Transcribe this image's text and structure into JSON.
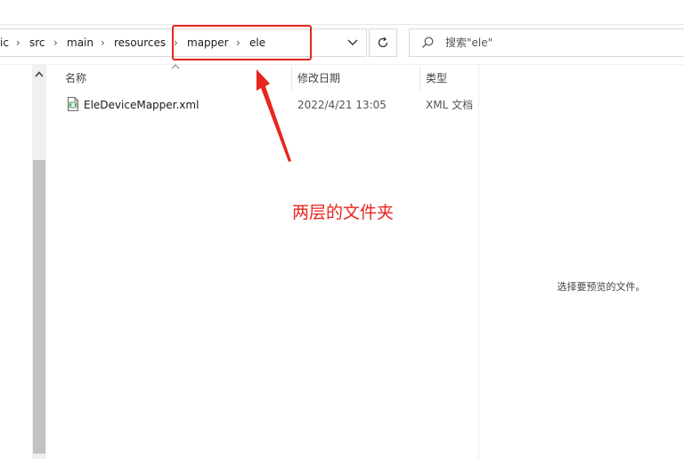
{
  "address_bar": {
    "crumbs": [
      "ic",
      "src",
      "main",
      "resources",
      "mapper",
      "ele"
    ],
    "separator": "›"
  },
  "search": {
    "placeholder": "搜索\"ele\""
  },
  "columns": {
    "name": "名称",
    "modified": "修改日期",
    "type": "类型"
  },
  "files": [
    {
      "name": "EleDeviceMapper.xml",
      "modified": "2022/4/21 13:05",
      "type": "XML 文档"
    }
  ],
  "preview": {
    "message": "选择要预览的文件。"
  },
  "annotation": {
    "text": "两层的文件夹",
    "color": "#e8261f"
  },
  "icons": {
    "dropdown": "chevron-down-icon",
    "refresh": "refresh-icon",
    "search": "search-icon",
    "scroll_up": "chevron-up-icon",
    "file": "xml-file-icon",
    "sort": "sort-ascending-icon"
  },
  "colors": {
    "highlight": "#e8261f",
    "scroll_thumb": "#c2c2c2"
  }
}
